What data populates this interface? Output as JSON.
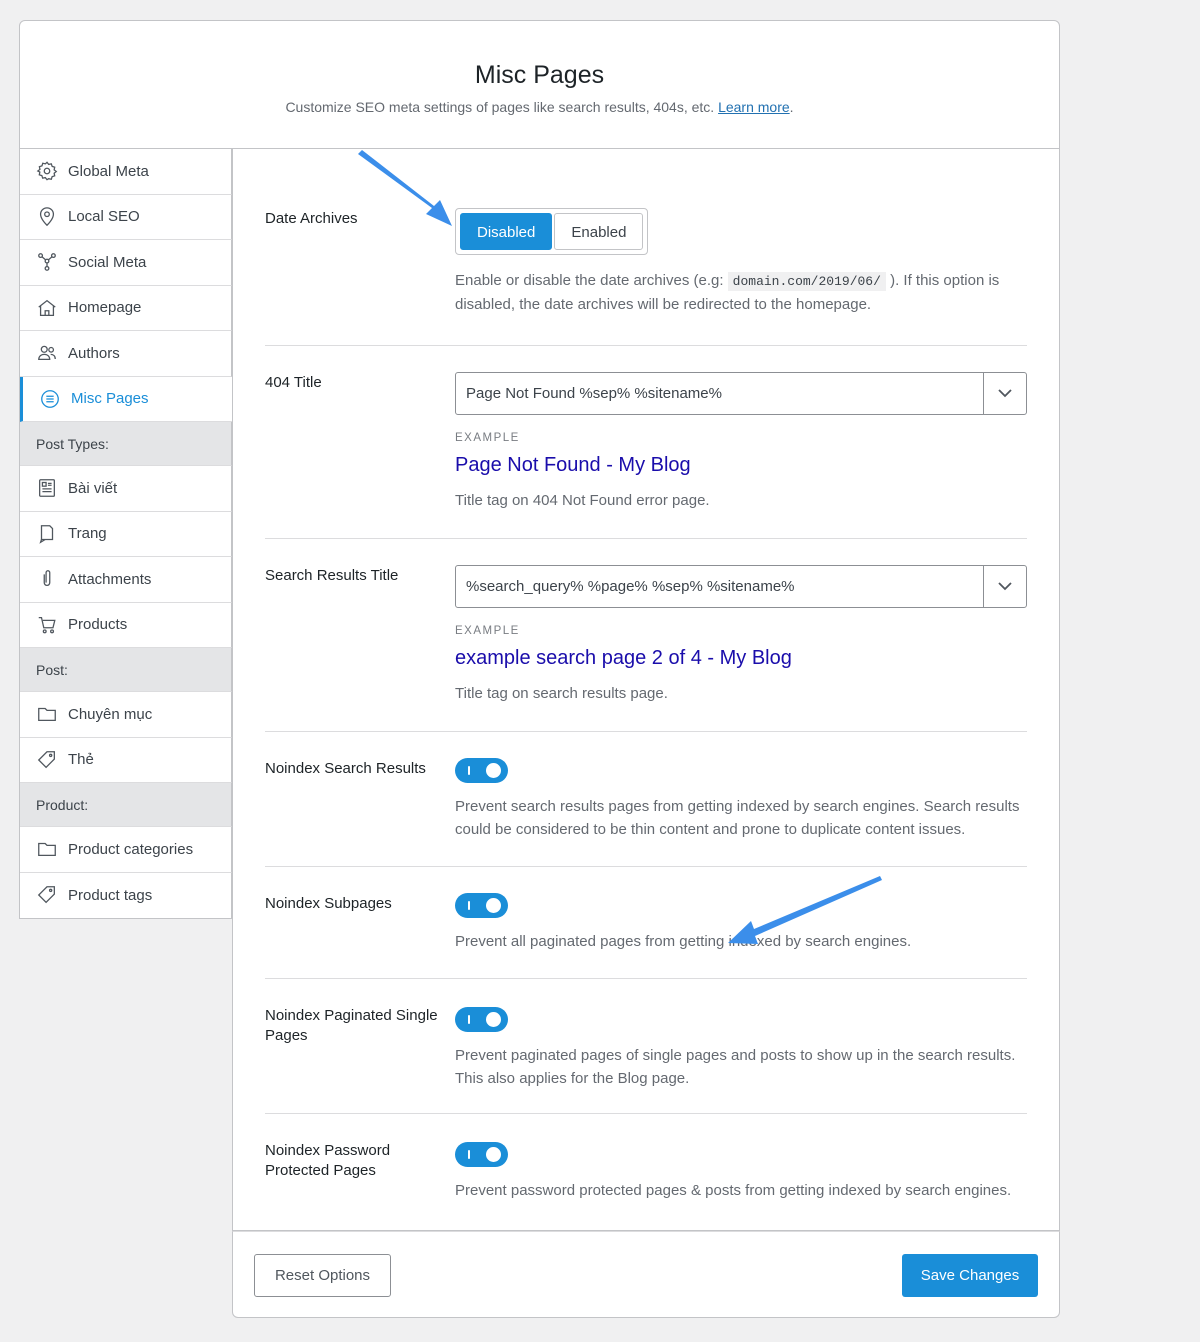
{
  "header": {
    "title": "Misc Pages",
    "subtitle": "Customize SEO meta settings of pages like search results, 404s, etc.",
    "learn_more": "Learn more",
    "period": "."
  },
  "sidebar": {
    "items": [
      {
        "label": "Global Meta",
        "icon": "gear-icon"
      },
      {
        "label": "Local SEO",
        "icon": "location-pin-icon"
      },
      {
        "label": "Social Meta",
        "icon": "share-network-icon"
      },
      {
        "label": "Homepage",
        "icon": "home-icon"
      },
      {
        "label": "Authors",
        "icon": "users-icon"
      },
      {
        "label": "Misc Pages",
        "icon": "list-circle-icon",
        "active": true
      }
    ],
    "post_types_heading": "Post Types:",
    "post_types": [
      {
        "label": "Bài viết",
        "icon": "post-icon"
      },
      {
        "label": "Trang",
        "icon": "page-icon"
      },
      {
        "label": "Attachments",
        "icon": "paperclip-icon"
      },
      {
        "label": "Products",
        "icon": "cart-icon"
      }
    ],
    "post_heading": "Post:",
    "post": [
      {
        "label": "Chuyên mục",
        "icon": "folder-icon"
      },
      {
        "label": "Thẻ",
        "icon": "tag-icon"
      }
    ],
    "product_heading": "Product:",
    "product": [
      {
        "label": "Product categories",
        "icon": "folder-icon"
      },
      {
        "label": "Product tags",
        "icon": "tag-icon"
      }
    ]
  },
  "settings": {
    "date_archives": {
      "label": "Date Archives",
      "option_disabled": "Disabled",
      "option_enabled": "Enabled",
      "selected": "Disabled",
      "desc_before": "Enable or disable the date archives (e.g:",
      "desc_code": "domain.com/2019/06/",
      "desc_after": "). If this option is disabled, the date archives will be redirected to the homepage."
    },
    "title_404": {
      "label": "404 Title",
      "value": "Page Not Found %sep% %sitename%",
      "example_label": "EXAMPLE",
      "example": "Page Not Found - My Blog",
      "desc": "Title tag on 404 Not Found error page."
    },
    "search_title": {
      "label": "Search Results Title",
      "value": "%search_query% %page% %sep% %sitename%",
      "example_label": "EXAMPLE",
      "example": "example search page 2 of 4 - My Blog",
      "desc": "Title tag on search results page."
    },
    "noindex_search": {
      "label": "Noindex Search Results",
      "enabled": true,
      "desc": "Prevent search results pages from getting indexed by search engines. Search results could be considered to be thin content and prone to duplicate content issues."
    },
    "noindex_subpages": {
      "label": "Noindex Subpages",
      "enabled": true,
      "desc": "Prevent all paginated pages from getting indexed by search engines."
    },
    "noindex_paginated_single": {
      "label": "Noindex Paginated Single Pages",
      "enabled": true,
      "desc": "Prevent paginated pages of single pages and posts to show up in the search results. This also applies for the Blog page."
    },
    "noindex_password": {
      "label": "Noindex Password Protected Pages",
      "enabled": true,
      "desc": "Prevent password protected pages & posts from getting indexed by search engines."
    }
  },
  "footer": {
    "reset": "Reset Options",
    "save": "Save Changes"
  },
  "colors": {
    "accent": "#1a8ed8",
    "example_link": "#1a0dab",
    "annotation_arrow": "#3b8eea"
  }
}
